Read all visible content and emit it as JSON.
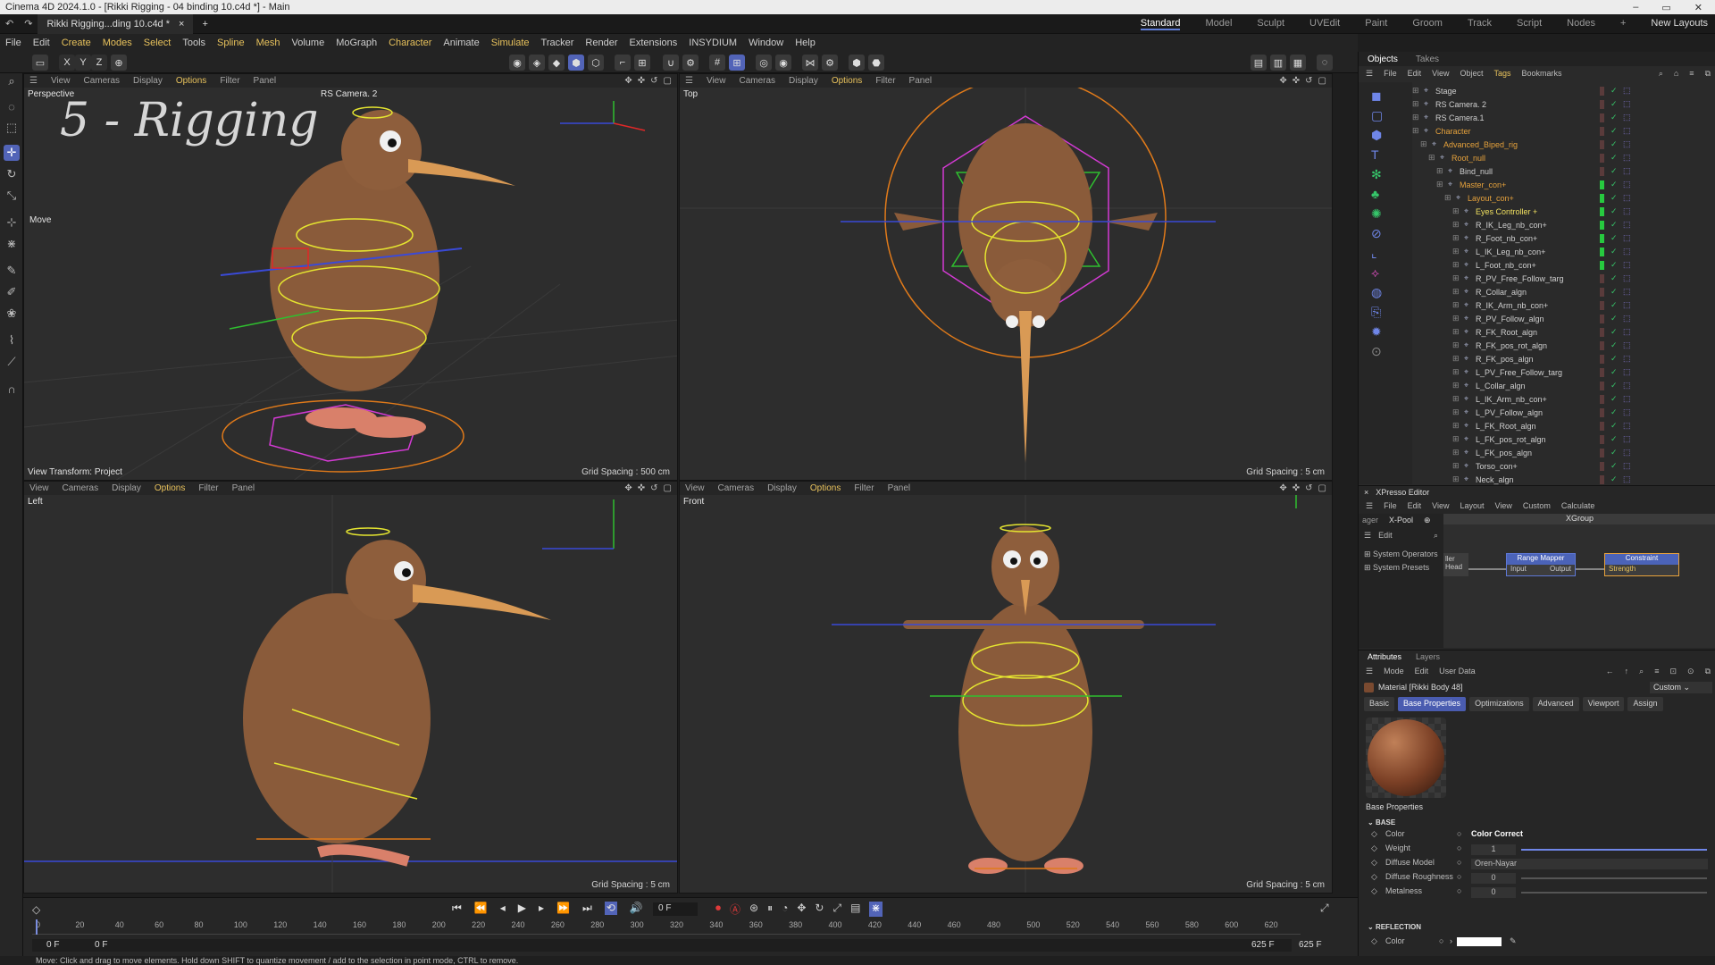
{
  "window": {
    "title": "Cinema 4D 2024.1.0 - [Rikki Rigging - 04 binding 10.c4d *] - Main",
    "controls": [
      "–",
      "▭",
      "✕"
    ]
  },
  "tabs": {
    "document": "Rikki Rigging...ding 10.c4d *",
    "add": "+",
    "layouts": [
      "Standard",
      "Model",
      "Sculpt",
      "UVEdit",
      "Paint",
      "Groom",
      "Track",
      "Script",
      "Nodes"
    ],
    "active_layout": "Standard",
    "new_layouts": "New Layouts"
  },
  "menu": [
    "File",
    "Edit",
    "Create",
    "Modes",
    "Select",
    "Tools",
    "Spline",
    "Mesh",
    "Volume",
    "MoGraph",
    "Character",
    "Animate",
    "Simulate",
    "Tracker",
    "Render",
    "Extensions",
    "INSYDIUM",
    "Window",
    "Help"
  ],
  "menu_highlight": [
    "Create",
    "Modes",
    "Select",
    "Spline",
    "Mesh",
    "Character",
    "Simulate"
  ],
  "axis_buttons": [
    "X",
    "Y",
    "Z"
  ],
  "viewports": {
    "menu": [
      "View",
      "Cameras",
      "Display",
      "Options",
      "Filter",
      "Panel"
    ],
    "perspective": {
      "name": "Perspective",
      "camera": "RS Camera. 2",
      "overlay": "5 - Rigging",
      "move_label": "Move",
      "view_transform": "View Transform: Project",
      "grid": "Grid Spacing : 500 cm"
    },
    "top": {
      "name": "Top",
      "grid": "Grid Spacing : 5 cm"
    },
    "left": {
      "name": "Left",
      "grid": "Grid Spacing : 5 cm"
    },
    "front": {
      "name": "Front",
      "grid": "Grid Spacing : 5 cm"
    }
  },
  "timeline": {
    "ticks": [
      "0",
      "20",
      "40",
      "60",
      "80",
      "100",
      "120",
      "140",
      "160",
      "180",
      "200",
      "220",
      "240",
      "260",
      "280",
      "300",
      "320",
      "340",
      "360",
      "380",
      "400",
      "420",
      "440",
      "460",
      "480",
      "500",
      "520",
      "540",
      "560",
      "580",
      "600",
      "620"
    ],
    "current_frame": "0 F",
    "start": "0 F",
    "start2": "0 F",
    "end": "625 F",
    "end2": "625 F"
  },
  "status": "Move: Click and drag to move elements. Hold down SHIFT to quantize movement / add to the selection in point mode, CTRL to remove.",
  "objects": {
    "tabs": [
      "Objects",
      "Takes"
    ],
    "menu": [
      "File",
      "Edit",
      "View",
      "Object",
      "Tags",
      "Bookmarks"
    ],
    "rows": [
      {
        "name": "Stage",
        "indent": 0,
        "color": "#d0d0d0"
      },
      {
        "name": "RS Camera. 2",
        "indent": 0,
        "color": "#d0d0d0"
      },
      {
        "name": "RS Camera.1",
        "indent": 0,
        "color": "#d0d0d0"
      },
      {
        "name": "Character",
        "indent": 0,
        "color": "#e6a23c"
      },
      {
        "name": "Advanced_Biped_rig",
        "indent": 1,
        "color": "#e6a23c"
      },
      {
        "name": "Root_null",
        "indent": 2,
        "color": "#e6a23c"
      },
      {
        "name": "Bind_null",
        "indent": 3,
        "color": "#d0d0d0"
      },
      {
        "name": "Master_con+",
        "indent": 3,
        "color": "#e6a23c"
      },
      {
        "name": "Layout_con+",
        "indent": 4,
        "color": "#e6a23c"
      },
      {
        "name": "Eyes Controller +",
        "indent": 5,
        "color": "#f0e060"
      },
      {
        "name": "R_IK_Leg_nb_con+",
        "indent": 5,
        "color": "#d0d0d0"
      },
      {
        "name": "R_Foot_nb_con+",
        "indent": 5,
        "color": "#d0d0d0"
      },
      {
        "name": "L_IK_Leg_nb_con+",
        "indent": 5,
        "color": "#d0d0d0"
      },
      {
        "name": "L_Foot_nb_con+",
        "indent": 5,
        "color": "#d0d0d0"
      },
      {
        "name": "R_PV_Free_Follow_targ",
        "indent": 5,
        "color": "#d0d0d0"
      },
      {
        "name": "R_Collar_algn",
        "indent": 5,
        "color": "#d0d0d0"
      },
      {
        "name": "R_IK_Arm_nb_con+",
        "indent": 5,
        "color": "#d0d0d0"
      },
      {
        "name": "R_PV_Follow_algn",
        "indent": 5,
        "color": "#d0d0d0"
      },
      {
        "name": "R_FK_Root_algn",
        "indent": 5,
        "color": "#d0d0d0"
      },
      {
        "name": "R_FK_pos_rot_algn",
        "indent": 5,
        "color": "#d0d0d0"
      },
      {
        "name": "R_FK_pos_algn",
        "indent": 5,
        "color": "#d0d0d0"
      },
      {
        "name": "L_PV_Free_Follow_targ",
        "indent": 5,
        "color": "#d0d0d0"
      },
      {
        "name": "L_Collar_algn",
        "indent": 5,
        "color": "#d0d0d0"
      },
      {
        "name": "L_IK_Arm_nb_con+",
        "indent": 5,
        "color": "#d0d0d0"
      },
      {
        "name": "L_PV_Follow_algn",
        "indent": 5,
        "color": "#d0d0d0"
      },
      {
        "name": "L_FK_Root_algn",
        "indent": 5,
        "color": "#d0d0d0"
      },
      {
        "name": "L_FK_pos_rot_algn",
        "indent": 5,
        "color": "#d0d0d0"
      },
      {
        "name": "L_FK_pos_algn",
        "indent": 5,
        "color": "#d0d0d0"
      },
      {
        "name": "Torso_con+",
        "indent": 5,
        "color": "#d0d0d0"
      },
      {
        "name": "Neck_algn",
        "indent": 5,
        "color": "#d0d0d0"
      }
    ]
  },
  "xpresso": {
    "title": "XPresso Editor",
    "menu": [
      "File",
      "Edit",
      "View",
      "Layout",
      "View",
      "Custom",
      "Calculate"
    ],
    "pool_tabs": [
      "ager",
      "X-Pool"
    ],
    "pool_edit": "Edit",
    "pool_items": [
      "System Operators",
      "System Presets"
    ],
    "group": "XGroup",
    "nodes": {
      "left_out": "ller",
      "left_port": "Head",
      "range_mapper": "Range Mapper",
      "rm_input": "Input",
      "rm_output": "Output",
      "constraint": "Constraint",
      "c_strength": "Strength"
    }
  },
  "attributes": {
    "tabs": [
      "Attributes",
      "Layers"
    ],
    "menu": [
      "Mode",
      "Edit",
      "User Data"
    ],
    "material": "Material [Rikki Body 48]",
    "preset": "Custom",
    "subtabs": [
      "Basic",
      "Base Properties",
      "Optimizations",
      "Advanced",
      "Viewport",
      "Assign"
    ],
    "active_subtab": "Base Properties",
    "section": "Base Properties",
    "group_base": "BASE",
    "params": [
      {
        "label": "Color",
        "value": "Color Correct"
      },
      {
        "label": "Weight",
        "value": "1"
      },
      {
        "label": "Diffuse Model",
        "value": "Oren-Nayar"
      },
      {
        "label": "Diffuse Roughness",
        "value": "0"
      },
      {
        "label": "Metalness",
        "value": "0"
      }
    ],
    "weight_fraction": 1,
    "group_reflection": "REFLECTION",
    "reflection_color_label": "Color"
  }
}
